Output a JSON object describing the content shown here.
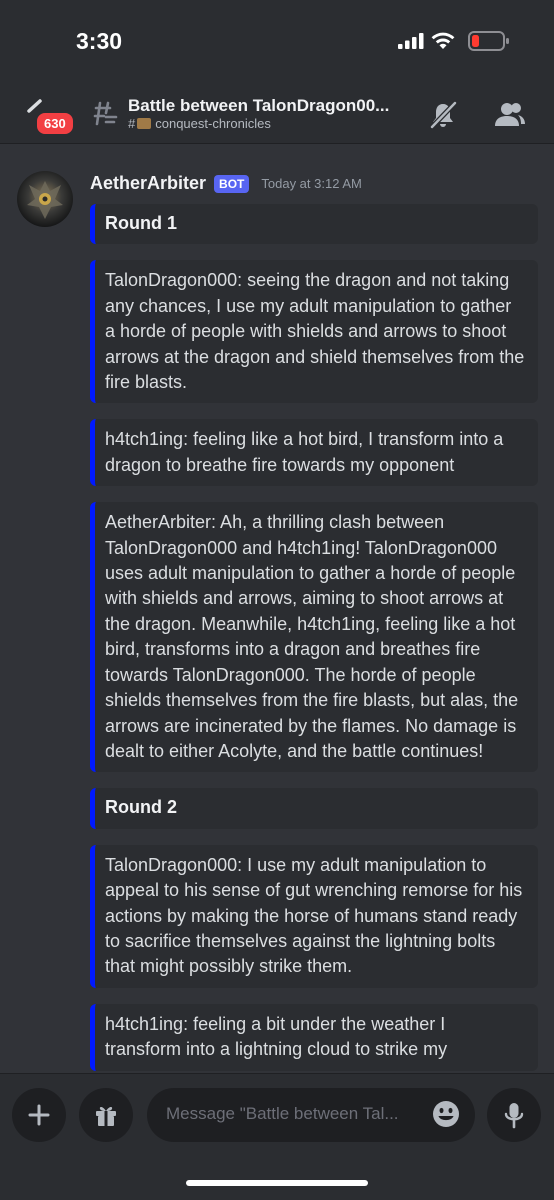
{
  "status_bar": {
    "time": "3:30"
  },
  "header": {
    "badge_count": "630",
    "thread_title": "Battle between TalonDragon00...",
    "channel_prefix": "#",
    "channel_name": "conquest-chronicles"
  },
  "message": {
    "author": "AetherArbiter",
    "bot_tag": "BOT",
    "timestamp": "Today at 3:12 AM",
    "embed_color": "#0019ff",
    "embeds": [
      {
        "kind": "title",
        "text": "Round 1"
      },
      {
        "kind": "body",
        "text": "TalonDragon000: seeing the dragon and not taking any chances, I use my adult manipulation to gather a horde of people with shields and arrows to shoot arrows at the dragon and shield themselves from the fire blasts."
      },
      {
        "kind": "body",
        "text": "h4tch1ing: feeling like a hot bird, I transform into a dragon to breathe fire towards my opponent"
      },
      {
        "kind": "body",
        "text": "AetherArbiter: Ah, a thrilling clash between TalonDragon000 and h4tch1ing! TalonDragon000 uses adult manipulation to gather a horde of people with shields and arrows, aiming to shoot arrows at the dragon. Meanwhile, h4tch1ing, feeling like a hot bird, transforms into a dragon and breathes fire towards TalonDragon000. The horde of people shields themselves from the fire blasts, but alas, the arrows are incinerated by the flames. No damage is dealt to either Acolyte, and the battle continues!"
      },
      {
        "kind": "title",
        "text": "Round 2"
      },
      {
        "kind": "body",
        "text": "TalonDragon000: I use my adult manipulation to appeal to his sense of gut wrenching remorse for his actions by making the horse of humans stand ready to sacrifice themselves against the lightning bolts that might possibly strike them."
      },
      {
        "kind": "body",
        "text": "h4tch1ing: feeling a bit under the weather I transform into a lightning cloud to strike my"
      }
    ]
  },
  "composer": {
    "placeholder": "Message \"Battle between Tal..."
  },
  "icons": {
    "back": "back-chevron-icon",
    "thread": "thread-icon",
    "mute": "bell-muted-icon",
    "members": "members-icon",
    "plus": "plus-icon",
    "gift": "gift-icon",
    "emoji": "emoji-icon",
    "mic": "microphone-icon"
  }
}
